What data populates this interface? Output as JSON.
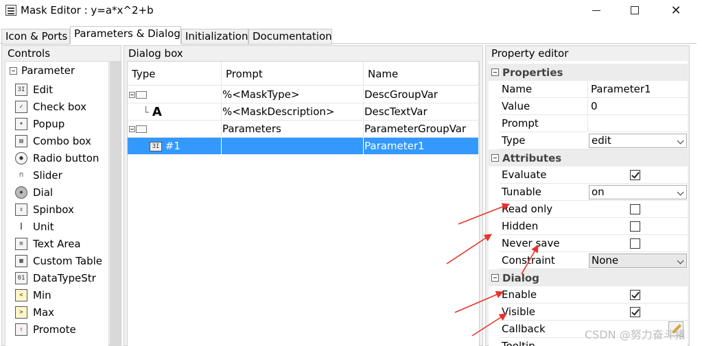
{
  "window": {
    "title": "Mask Editor : y=a*x^2+b"
  },
  "tabs": [
    {
      "label": "Icon & Ports"
    },
    {
      "label": "Parameters & Dialog"
    },
    {
      "label": "Initialization"
    },
    {
      "label": "Documentation"
    }
  ],
  "controls": {
    "title": "Controls",
    "group": "Parameter",
    "items": [
      {
        "label": "Edit",
        "icon": "edit-icon"
      },
      {
        "label": "Check box",
        "icon": "checkbox-icon"
      },
      {
        "label": "Popup",
        "icon": "popup-icon"
      },
      {
        "label": "Combo box",
        "icon": "combobox-icon"
      },
      {
        "label": "Radio button",
        "icon": "radio-button-icon"
      },
      {
        "label": "Slider",
        "icon": "slider-icon"
      },
      {
        "label": "Dial",
        "icon": "dial-icon"
      },
      {
        "label": "Spinbox",
        "icon": "spinbox-icon"
      },
      {
        "label": "Unit",
        "icon": "unit-icon"
      },
      {
        "label": "Text Area",
        "icon": "text-area-icon"
      },
      {
        "label": "Custom Table",
        "icon": "table-icon"
      },
      {
        "label": "DataTypeStr",
        "icon": "datatype-icon"
      },
      {
        "label": "Min",
        "icon": "min-icon"
      },
      {
        "label": "Max",
        "icon": "max-icon"
      },
      {
        "label": "Promote",
        "icon": "promote-icon"
      }
    ]
  },
  "dialog": {
    "title": "Dialog box",
    "columns": [
      "Type",
      "Prompt",
      "Name"
    ],
    "rows": [
      {
        "type": "",
        "prompt": "%<MaskType>",
        "name": "DescGroupVar"
      },
      {
        "type": "A",
        "prompt": "%<MaskDescription>",
        "name": "DescTextVar"
      },
      {
        "type": "",
        "prompt": "Parameters",
        "name": "ParameterGroupVar"
      },
      {
        "type": "#1",
        "prompt": "",
        "name": "Parameter1"
      }
    ]
  },
  "property_editor": {
    "title": "Property editor",
    "sections": {
      "properties": "Properties",
      "attributes": "Attributes",
      "dialog": "Dialog"
    },
    "properties": {
      "name_label": "Name",
      "name_value": "Parameter1",
      "value_label": "Value",
      "value_value": "0",
      "prompt_label": "Prompt",
      "prompt_value": "",
      "type_label": "Type",
      "type_value": "edit"
    },
    "attributes": {
      "evaluate_label": "Evaluate",
      "evaluate_checked": true,
      "tunable_label": "Tunable",
      "tunable_value": "on",
      "read_only_label": "Read only",
      "read_only_checked": false,
      "hidden_label": "Hidden",
      "hidden_checked": false,
      "never_save_label": "Never save",
      "never_save_checked": false,
      "constraint_label": "Constraint",
      "constraint_value": "None"
    },
    "dialog": {
      "enable_label": "Enable",
      "enable_checked": true,
      "visible_label": "Visible",
      "visible_checked": true,
      "callback_label": "Callback",
      "tooltip_label": "Tooltip"
    }
  },
  "watermark": "CSDN @努力奋斗猪",
  "colors": {
    "selection": "#3399ff",
    "annotation_arrow": "#e8322a"
  }
}
